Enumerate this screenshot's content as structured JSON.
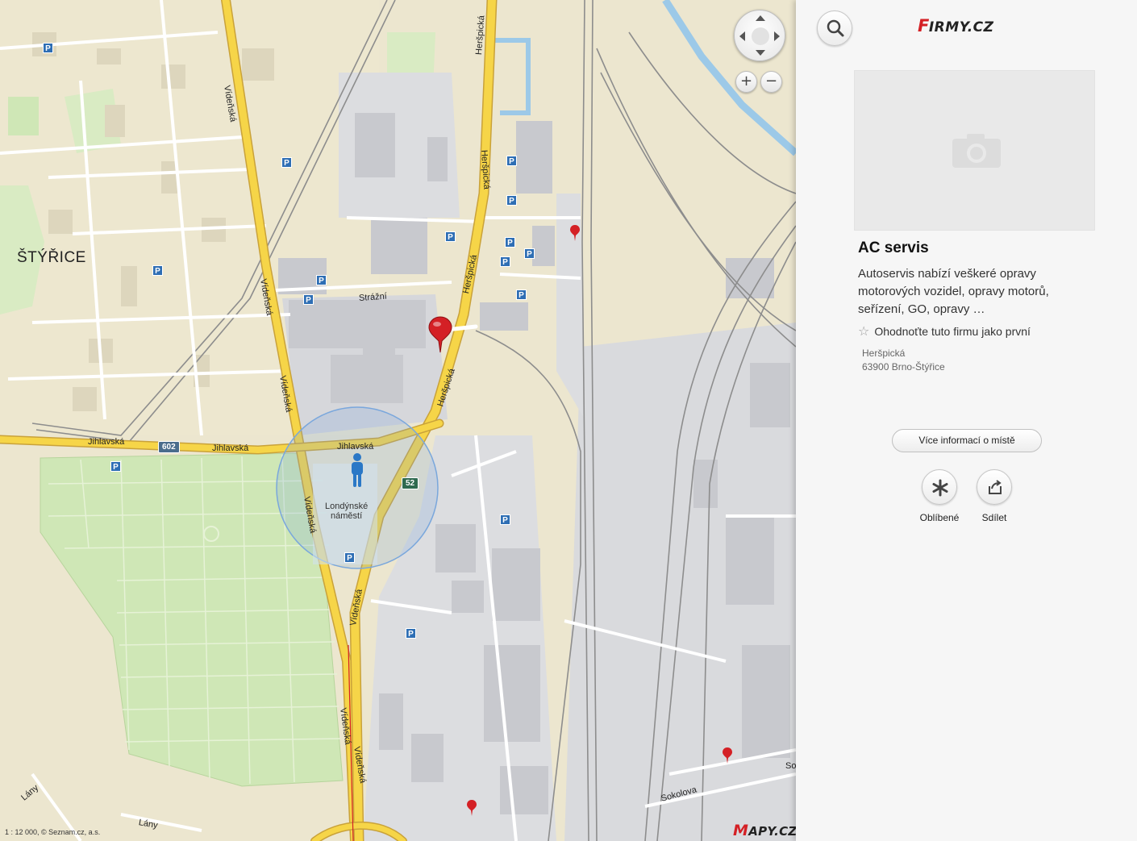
{
  "map": {
    "district_label": "ŠTÝŘICE",
    "streets": {
      "videnska": "Vídeňská",
      "herspicka": "Heršpická",
      "jihlavska": "Jihlavská",
      "strazni": "Strážní",
      "sokolova": "Sokolova",
      "lany": "Lány",
      "so": "So"
    },
    "road_numbers": {
      "r602": "602",
      "r52": "52"
    },
    "place_label_line1": "Londýnské",
    "place_label_line2": "náměstí",
    "parking_symbol": "P",
    "scale": "1 : 12 000, © Seznam.cz, a.s.",
    "logo_initial": "M",
    "logo_rest": "APY.CZ",
    "controls": {
      "zoom_in": "+",
      "zoom_out": "−"
    },
    "colors": {
      "motorway": "#f6d548",
      "park": "#cfe7b6",
      "water": "#9cc9e8",
      "building": "#d4d4d8",
      "industrial": "#e3e3e6",
      "marker": "#d42025",
      "you_are_here": "#2b78c6"
    },
    "icons": [
      "pan-up-icon",
      "pan-down-icon",
      "pan-left-icon",
      "pan-right-icon",
      "map-marker-icon",
      "person-location-icon"
    ]
  },
  "panel": {
    "logo_initial": "F",
    "logo_rest": "IRMY.CZ",
    "photo_placeholder_icon": "camera-icon",
    "title": "AC servis",
    "description": "Autoservis nabízí veškeré opravy motorových vozidel, opravy motorů, seřízení, GO, opravy …",
    "rating_star": "☆",
    "rating_text": "Ohodnoťte tuto firmu jako první",
    "address_street": "Heršpická",
    "address_city": "63900 Brno-Štýřice",
    "more_info": "Více informací o místě",
    "favorites": "Oblíbené",
    "share": "Sdílet",
    "icons": [
      "search-icon",
      "camera-icon",
      "star-icon",
      "asterisk-icon",
      "share-icon"
    ]
  }
}
